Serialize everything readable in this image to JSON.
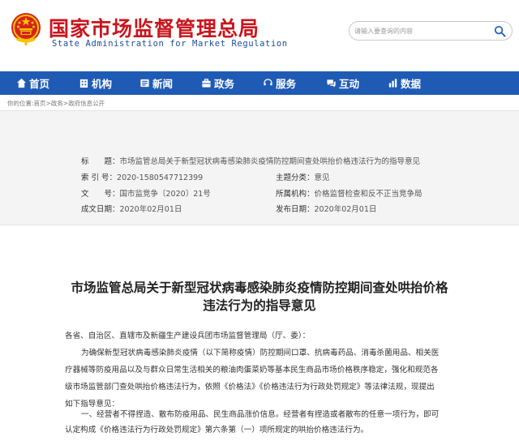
{
  "header": {
    "title": "国家市场监督管理总局",
    "subtitle": "State Administration for Market Regulation",
    "search_placeholder": "请输入要查询的内容",
    "brand_red": "#c8161d",
    "brand_blue": "#1f5bb4"
  },
  "nav": {
    "items": [
      {
        "label": "首页",
        "icon": "home-icon"
      },
      {
        "label": "机构",
        "icon": "building-icon"
      },
      {
        "label": "新闻",
        "icon": "news-icon"
      },
      {
        "label": "政务",
        "icon": "affairs-icon"
      },
      {
        "label": "服务",
        "icon": "service-icon"
      },
      {
        "label": "互动",
        "icon": "interact-icon"
      },
      {
        "label": "数据",
        "icon": "data-icon"
      }
    ]
  },
  "breadcrumb": "你的位置:首页>政务>政府信息公开",
  "meta": {
    "title_label": "标　　题：",
    "title_value": "市场监管总局关于新型冠状病毒感染肺炎疫情防控期间查处哄抬价格违法行为的指导意见",
    "index_label": "索 引 号：",
    "index_value": "2020-1580547712399",
    "category_label": "主题分类：",
    "category_value": "意见",
    "doc_no_label": "文　　号：",
    "doc_no_value": "国市监竞争〔2020〕21号",
    "dept_label": "所属机构：",
    "dept_value": "价格监督检查和反不正当竞争局",
    "created_label": "成文日期：",
    "created_value": "2020年02月01日",
    "published_label": "发布日期：",
    "published_value": "2020年02月01日"
  },
  "article": {
    "title_line1": "市场监管总局关于新型冠状病毒感染肺炎疫情防控期间查处哄抬价格",
    "title_line2": "违法行为的指导意见",
    "salutation": "各省、自治区、直辖市及新疆生产建设兵团市场监督管理局（厅、委）：",
    "para1_l1": "为确保新型冠状病毒感染肺炎疫情（以下简称疫情）防控期间口罩、抗病毒药品、消毒杀菌用品、相关医",
    "para1_l2": "疗器械等防疫用品以及与群众日常生活相关的粮油肉蛋菜奶等基本民生商品市场价格秩序稳定，强化和规范各",
    "para1_l3": "级市场监管部门查处哄抬价格违法行为，依照《价格法》《价格违法行为行政处罚规定》等法律法规，现提出",
    "para1_l4": "如下指导意见：",
    "para2_l1": "一、经营者不得捏造、散布防疫用品、民生商品涨价信息。经营者有捏造或者散布的任意一项行为，即可",
    "para2_l2": "认定构成《价格违法行为行政处罚规定》第六条第（一）项所规定的哄抬价格违法行为。"
  }
}
